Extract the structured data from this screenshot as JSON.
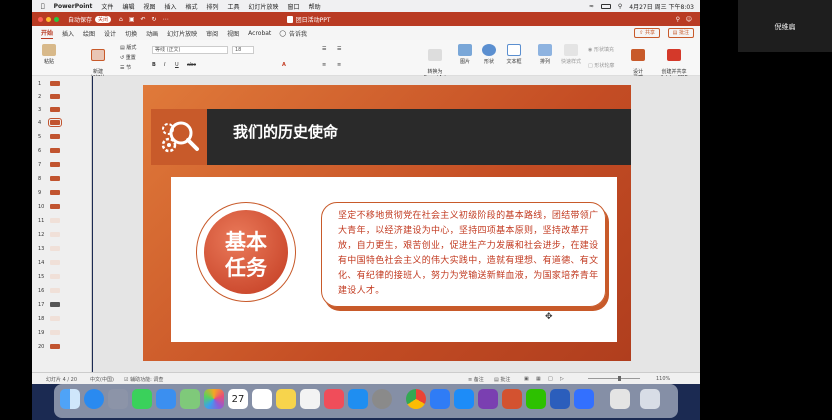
{
  "menubar": {
    "app": "PowerPoint",
    "items": [
      "文件",
      "编辑",
      "视图",
      "插入",
      "格式",
      "排列",
      "工具",
      "幻灯片放映",
      "窗口",
      "帮助"
    ],
    "clock": "4月27日 周三 下午8:03"
  },
  "titlebar": {
    "autosave": "自动保存",
    "toggle": "关闭",
    "doc_name": "团日活动PPT"
  },
  "tabs": [
    "开始",
    "插入",
    "绘图",
    "设计",
    "切换",
    "动画",
    "幻灯片放映",
    "审阅",
    "视图",
    "Acrobat"
  ],
  "tell_me": "告诉我",
  "share": "共享",
  "comments": "批注",
  "ribbon": {
    "paste": "粘贴",
    "new_slide": "新建\n幻灯片",
    "layout": "版式",
    "reset": "重置",
    "section": "节",
    "font": "等线 (正文)",
    "size": "18",
    "convert_smartart": "转换为\nSmartArt",
    "picture": "图片",
    "shapes": "形状",
    "textbox": "文本框",
    "arrange": "排列",
    "quick_styles": "快速样式",
    "shape_fill": "形状填充",
    "shape_outline": "形状轮廓",
    "design_ideas": "设计\n灵感",
    "create_pdf": "创建并共享\nAdobe PDF"
  },
  "thumbnails": [
    "1",
    "2",
    "3",
    "4",
    "5",
    "6",
    "7",
    "8",
    "9",
    "10",
    "11",
    "12",
    "13",
    "14",
    "15",
    "16",
    "17",
    "18",
    "19",
    "20"
  ],
  "slide": {
    "title": "我们的历史使命",
    "circle_label": "基本\n任务",
    "body": "坚定不移地贯彻党在社会主义初级阶段的基本路线，团结带领广大青年，以经济建设为中心，坚持四项基本原则，坚持改革开放，自力更生，艰苦创业，促进生产力发展和社会进步，在建设有中国特色社会主义的伟大实践中，造就有理想、有道德、有文化、有纪律的接班人，努力为党输送新鲜血液，为国家培养青年建设人才。"
  },
  "statusbar": {
    "slide_count": "幻灯片 4 / 20",
    "language": "中文(中国)",
    "accessibility": "辅助功能: 调查",
    "notes": "备注",
    "comments": "批注",
    "zoom": "110%"
  },
  "dock_date": "27",
  "participant": "倪维扁"
}
